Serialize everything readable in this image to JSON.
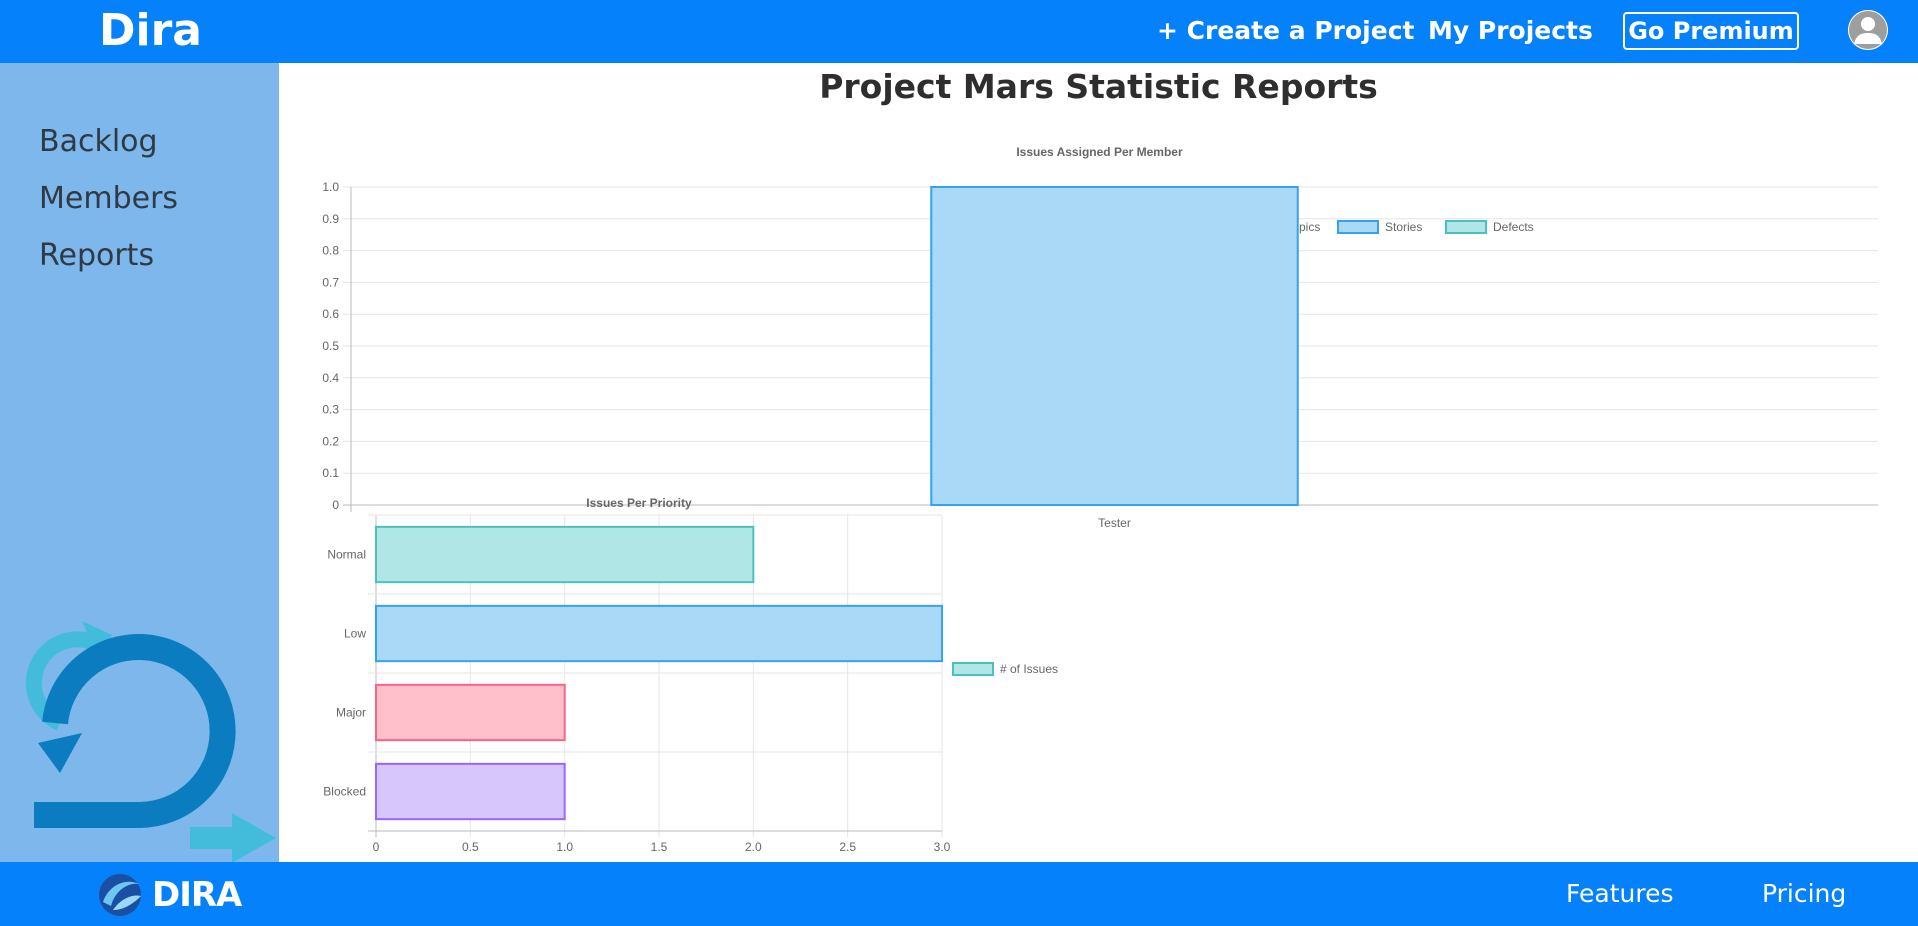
{
  "header": {
    "brand": "Dira",
    "create_project": "+ Create a Project",
    "my_projects": "My Projects",
    "go_premium": "Go Premium"
  },
  "sidebar": {
    "items": [
      {
        "label": "Backlog"
      },
      {
        "label": "Members"
      },
      {
        "label": "Reports"
      }
    ]
  },
  "main": {
    "title": "Project Mars Statistic Reports"
  },
  "footer": {
    "logo_text": "DIRA",
    "features": "Features",
    "pricing": "Pricing"
  },
  "colors": {
    "brand_blue": "#0481fb",
    "sidebar_blue": "#7eb7ec",
    "pink_fill": "#ffc0cc",
    "pink_stroke": "#ff6384",
    "blue_fill": "#a9d9f7",
    "blue_stroke": "#36a2eb",
    "teal_fill": "#b1e6e6",
    "teal_stroke": "#4bc0c0",
    "purple_fill": "#d6c6fc",
    "purple_stroke": "#9966ff"
  },
  "chart_data": [
    {
      "type": "bar",
      "title": "Issues Assigned Per Member",
      "categories": [
        "Tester"
      ],
      "series": [
        {
          "name": "Epics",
          "values": [
            0
          ],
          "fill": "#ffc0cc",
          "stroke": "#ff6384"
        },
        {
          "name": "Stories",
          "values": [
            1
          ],
          "fill": "#a9d9f7",
          "stroke": "#36a2eb"
        },
        {
          "name": "Defects",
          "values": [
            0
          ],
          "fill": "#b1e6e6",
          "stroke": "#4bc0c0"
        }
      ],
      "yticks": [
        "0",
        "0.1",
        "0.2",
        "0.3",
        "0.4",
        "0.5",
        "0.6",
        "0.7",
        "0.8",
        "0.9",
        "1.0"
      ],
      "ylim": [
        0,
        1
      ],
      "grid": true,
      "legend": "top"
    },
    {
      "type": "bar",
      "orientation": "horizontal",
      "title": "Issues Per Priority",
      "categories": [
        "Normal",
        "Low",
        "Major",
        "Blocked"
      ],
      "values": [
        2,
        3,
        1,
        1
      ],
      "fills": [
        "#b1e6e6",
        "#a9d9f7",
        "#ffc0cc",
        "#d6c6fc"
      ],
      "strokes": [
        "#4bc0c0",
        "#36a2eb",
        "#ff6384",
        "#9966ff"
      ],
      "series_name": "# of Issues",
      "xticks": [
        "0",
        "0.5",
        "1.0",
        "1.5",
        "2.0",
        "2.5",
        "3.0"
      ],
      "xlim": [
        0,
        3
      ],
      "grid": true,
      "legend": "right"
    }
  ]
}
